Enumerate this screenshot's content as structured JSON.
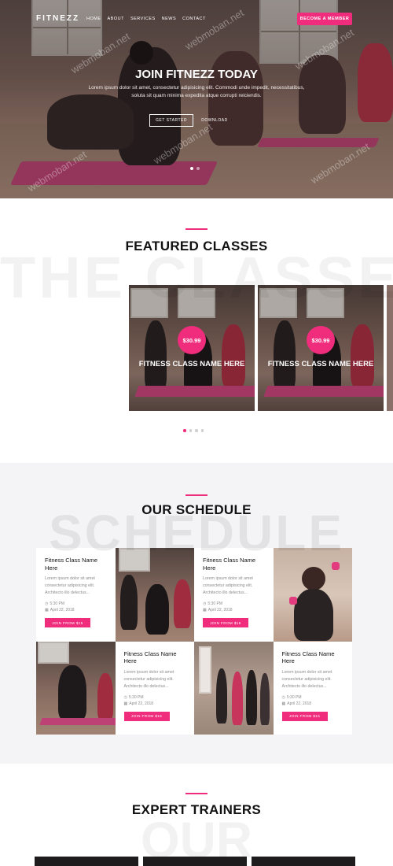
{
  "nav": {
    "logo": "FITNEZZ",
    "links": [
      "HOME",
      "ABOUT",
      "SERVICES",
      "NEWS",
      "CONTACT"
    ],
    "cta": "BECOME A MEMBER"
  },
  "hero": {
    "title": "JOIN FITNEZZ TODAY",
    "subtitle": "Lorem ipsum dolor sit amet, consectetur adipisicing elit. Commodi unde impedit, necessitatibus, soluta sit quam minima expedita atque corrupti reiciendis.",
    "primary_button": "GET STARTED",
    "secondary_button": "DOWNLOAD",
    "slides": 2,
    "active_slide": 0
  },
  "featured": {
    "title": "FEATURED CLASSES",
    "ghost": "THE CLASSES",
    "cards": [
      {
        "price": "$30.99",
        "name": "FITNESS CLASS NAME HERE"
      },
      {
        "price": "$30.99",
        "name": "FITNESS CLASS NAME HERE"
      }
    ],
    "dots": 4,
    "active_dot": 0
  },
  "schedule": {
    "title": "OUR SCHEDULE",
    "ghost": "SCHEDULE",
    "items": [
      {
        "name": "Fitness Class Name Here",
        "desc": "Lorem ipsum dolor sit amet consectetur adipisicing elit. Architecto illo delectus...",
        "time": "5:30 PM",
        "date": "April 22, 2018",
        "button": "JOIN FROM $15"
      },
      {
        "name": "Fitness Class Name Here",
        "desc": "Lorem ipsum dolor sit amet consectetur adipisicing elit. Architecto illo delectus...",
        "time": "5:30 PM",
        "date": "April 22, 2018",
        "button": "JOIN FROM $15"
      },
      {
        "name": "Fitness Class Name Here",
        "desc": "Lorem ipsum dolor sit amet consectetur adipisicing elit. Architecto illo delectus...",
        "time": "5:30 PM",
        "date": "April 22, 2018",
        "button": "JOIN FROM $15"
      },
      {
        "name": "Fitness Class Name Here",
        "desc": "Lorem ipsum dolor sit amet consectetur adipisicing elit. Architecto illo delectus...",
        "time": "5:30 PM",
        "date": "April 22, 2018",
        "button": "JOIN FROM $15"
      }
    ]
  },
  "trainers": {
    "title": "EXPERT TRAINERS",
    "ghost": "OUR"
  },
  "watermark": "webmoban.net",
  "colors": {
    "accent": "#f02d7d",
    "schedule_bg": "#f4f4f6"
  }
}
